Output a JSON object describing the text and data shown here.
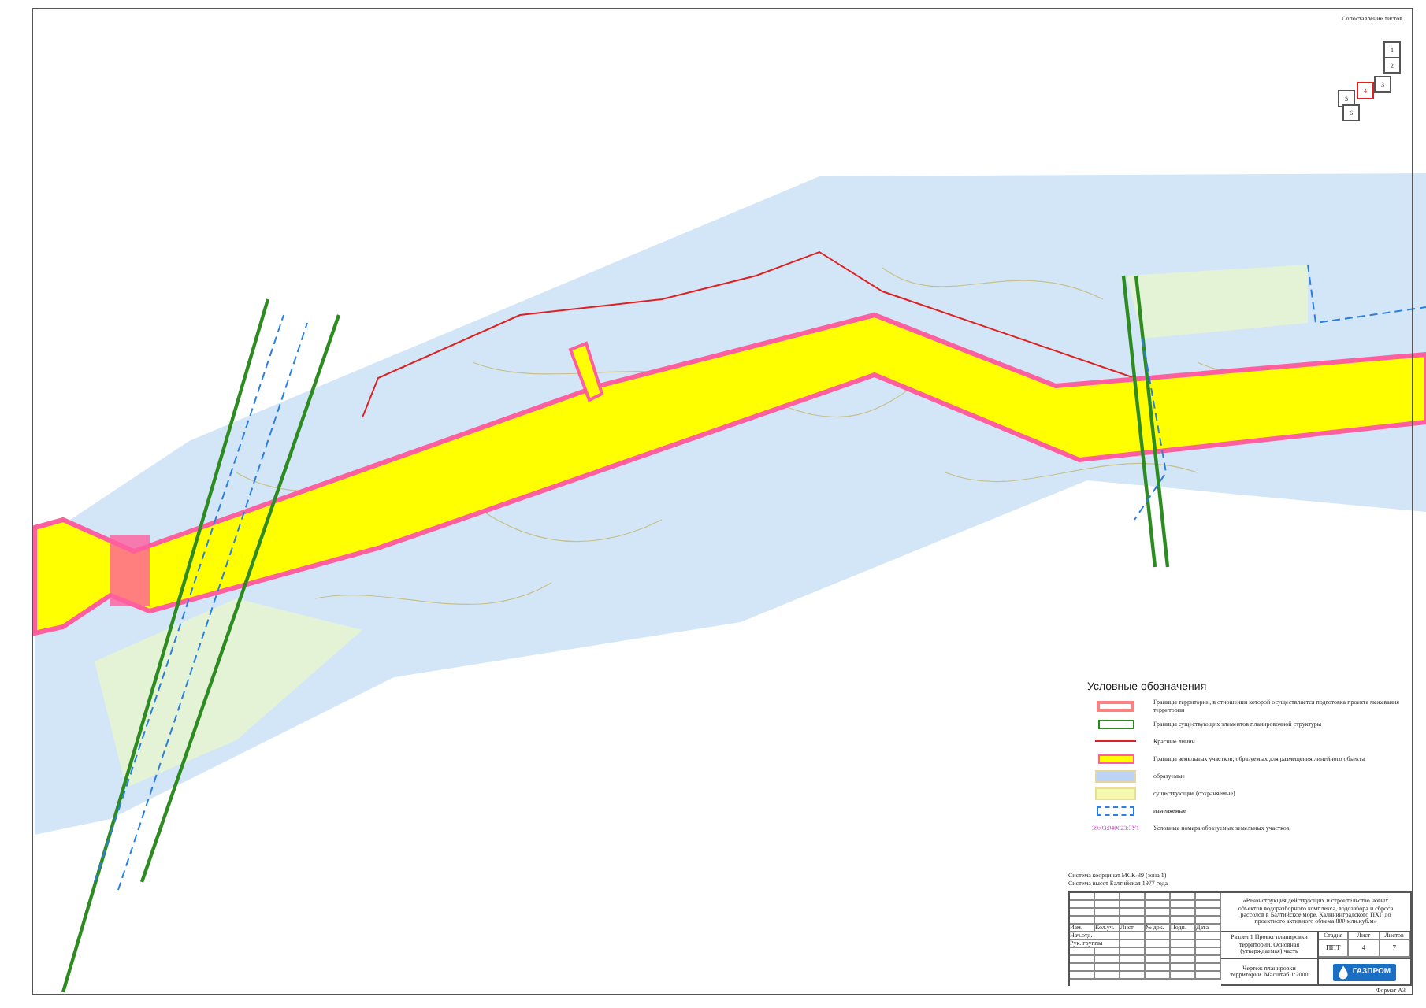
{
  "key_plan": {
    "title": "Сопоставление листов",
    "sheets": [
      {
        "number": "1",
        "selected": false
      },
      {
        "number": "2",
        "selected": false
      },
      {
        "number": "3",
        "selected": false
      },
      {
        "number": "4",
        "selected": true
      },
      {
        "number": "5",
        "selected": false
      },
      {
        "number": "6",
        "selected": false
      }
    ]
  },
  "legend": {
    "title": "Условные обозначения",
    "items": [
      {
        "kind": "boundary",
        "text": "Границы территории, в отношении которой осуществляется подготовка проекта межевания территории"
      },
      {
        "kind": "structure",
        "text": "Границы существующих элементов планировочной структуры"
      },
      {
        "kind": "redline",
        "text": "Красные линии"
      },
      {
        "kind": "parcel",
        "text": "Границы земельных участков, образуемых для размещения линейного объекта"
      },
      {
        "kind": "formed",
        "text": "образуемые"
      },
      {
        "kind": "existing",
        "text": "существующие (сохраняемые)"
      },
      {
        "kind": "changed",
        "text": "изменяемые"
      },
      {
        "kind": "number",
        "sample": "39:03:040023:ЗУ1",
        "text": "Условные номера образуемых земельных участков"
      }
    ]
  },
  "coordinates": [
    "Система координат МСК-39 (зона 1)",
    "Система высот Балтийская 1977 года"
  ],
  "title_block": {
    "project": "«Реконструкция действующих и строительство новых объектов водоразборного комплекса, водозабора и сброса рассолов в Балтийское море, Калининградского ПХГ до проектного активного объема 800 млн.куб.м»",
    "columns": [
      "Изм.",
      "Кол.уч.",
      "Лист",
      "№ док.",
      "Подп.",
      "Дата"
    ],
    "roles": [
      "Нач.отд.",
      "Рук. группы"
    ],
    "section": "Раздел 1 Проект планировки территории. Основная (утверждаемая) часть",
    "meta_headers": [
      "Стадия",
      "Лист",
      "Листов"
    ],
    "meta_values": [
      "ППТ",
      "4",
      "7"
    ],
    "drawing": "Чертеж планировки территории. Масштаб 1:2000",
    "logo": "ГАЗПРОМ"
  },
  "format": "Формат А3"
}
